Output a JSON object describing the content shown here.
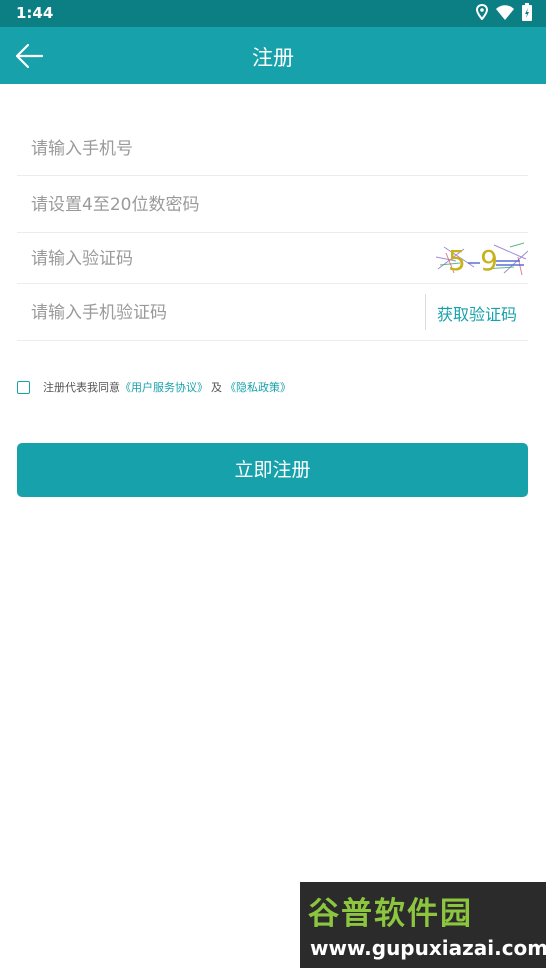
{
  "status_bar": {
    "time": "1:44",
    "icons": [
      "location-icon",
      "wifi-icon",
      "battery-icon"
    ]
  },
  "app_bar": {
    "back_icon": "arrow-left-icon",
    "title": "注册"
  },
  "form": {
    "phone_placeholder": "请输入手机号",
    "password_placeholder": "请设置4至20位数密码",
    "captcha_placeholder": "请输入验证码",
    "captcha_text": "59",
    "sms_code_placeholder": "请输入手机验证码",
    "get_code_label": "获取验证码"
  },
  "agreement": {
    "checked": false,
    "prefix": "注册代表我同意",
    "terms_link": "《用户服务协议》",
    "and": "及",
    "privacy_link": "《隐私政策》"
  },
  "submit": {
    "label": "立即注册"
  },
  "watermark": {
    "title": "谷普软件园",
    "url": "www.gupuxiazai.com"
  },
  "colors": {
    "primary": "#17a2ab",
    "status_bar": "#0c7f85",
    "placeholder": "#9a9a9a",
    "divider": "#ececec"
  }
}
